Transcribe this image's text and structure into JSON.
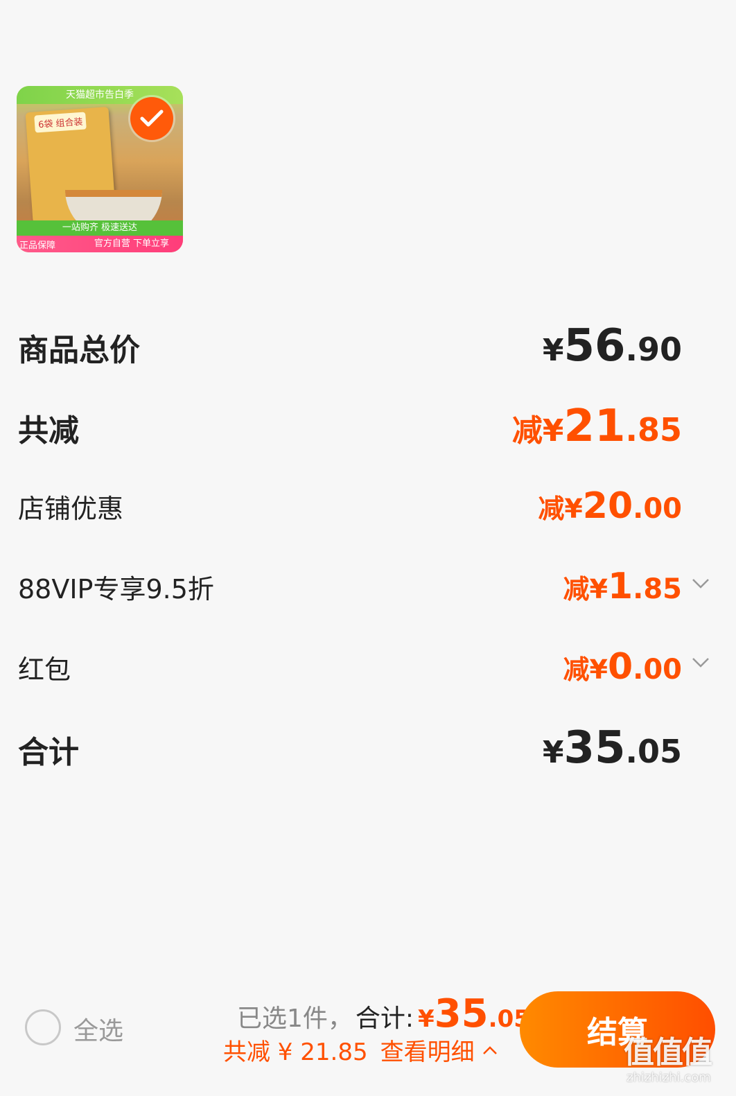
{
  "product": {
    "banner_text": "天猫超市告白季",
    "pack_tag": "6袋 组合装",
    "strip_top": "一站购齐 极速送达",
    "strip_bottom": "官方自营 下单立享",
    "guarantee": "正品保障",
    "selected": true
  },
  "summary": {
    "goods_total": {
      "label": "商品总价",
      "currency": "¥",
      "int": "56",
      "dec": ".90"
    },
    "total_discount": {
      "label": "共减",
      "prefix": "减¥",
      "int": "21",
      "dec": ".85"
    },
    "shop_discount": {
      "label": "店铺优惠",
      "prefix": "减¥",
      "int": "20",
      "dec": ".00"
    },
    "vip_discount": {
      "label": "88VIP专享9.5折",
      "prefix": "减¥",
      "int": "1",
      "dec": ".85"
    },
    "red_packet": {
      "label": "红包",
      "prefix": "减¥",
      "int": "0",
      "dec": ".00"
    },
    "grand_total": {
      "label": "合计",
      "currency": "¥",
      "int": "35",
      "dec": ".05"
    }
  },
  "bottom_bar": {
    "select_all": "全选",
    "selected_count": "已选1件，",
    "total_label": "合计:",
    "currency": "¥",
    "total_int": "35",
    "total_dec": ".05",
    "discount_text": "共减 ¥ 21.85",
    "view_detail": "查看明细",
    "checkout": "结算",
    "watermark": "值值值",
    "watermark_url": "zhizhizhi.com"
  },
  "colors": {
    "accent": "#ff5000",
    "text_dark": "#222222",
    "checkout_start": "#ff8a00",
    "checkout_end": "#ff4e00"
  }
}
